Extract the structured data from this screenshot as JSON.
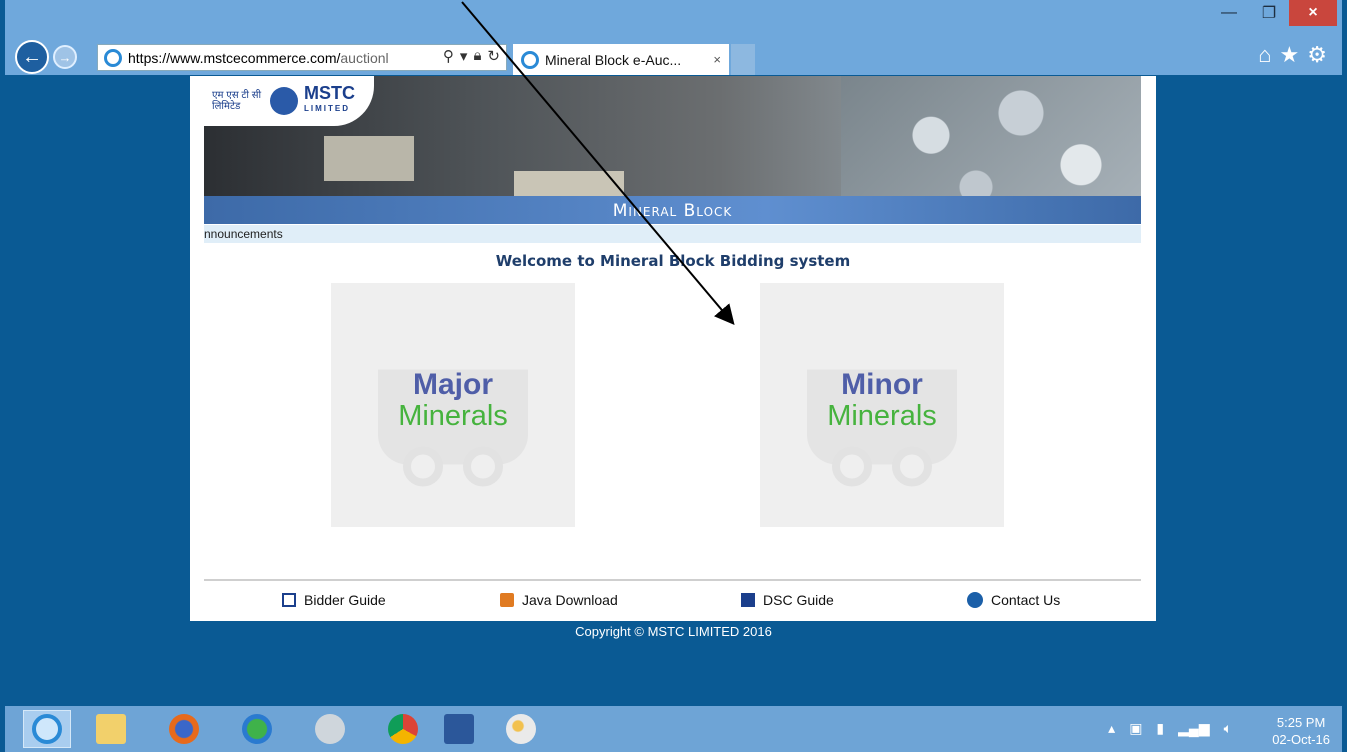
{
  "browser": {
    "url_host": "https://www.mstcecommerce.com/",
    "url_path": "auctionl",
    "tab_title": "Mineral Block e-Auc...",
    "tab_close": "×",
    "window_buttons": {
      "minimize": "—",
      "maximize": "❐",
      "close": "×"
    },
    "right_icons": [
      "home-icon",
      "favorites-star-icon",
      "settings-gear-icon"
    ]
  },
  "site": {
    "logo_hindi": "एम एस टी सी लिमिटेड",
    "logo_name": "MSTC",
    "logo_sub": "LIMITED",
    "banner_title": "Mineral Block",
    "marquee": "nnouncements",
    "welcome": "Welcome to Mineral Block Bidding system",
    "cards": [
      {
        "line1": "Major",
        "line2": "Minerals"
      },
      {
        "line1": "Minor",
        "line2": "Minerals"
      }
    ],
    "footer_links": [
      {
        "label": "Bidder Guide",
        "icon": "document-icon"
      },
      {
        "label": "Java Download",
        "icon": "java-icon"
      },
      {
        "label": "DSC Guide",
        "icon": "book-icon"
      },
      {
        "label": "Contact Us",
        "icon": "contact-icon"
      }
    ],
    "copyright": "Copyright © MSTC LIMITED 2016"
  },
  "taskbar": {
    "apps": [
      "internet-explorer-icon",
      "file-explorer-icon",
      "firefox-icon",
      "network-globe-icon",
      "tools-icon",
      "chrome-icon",
      "word-icon",
      "paint-icon"
    ],
    "time": "5:25 PM",
    "date": "02-Oct-16"
  },
  "colors": {
    "desktop_bg": "#0a5a94",
    "card_blue": "#4f5ea8",
    "card_green": "#46b33e",
    "welcome_text": "#1f3e6b"
  }
}
